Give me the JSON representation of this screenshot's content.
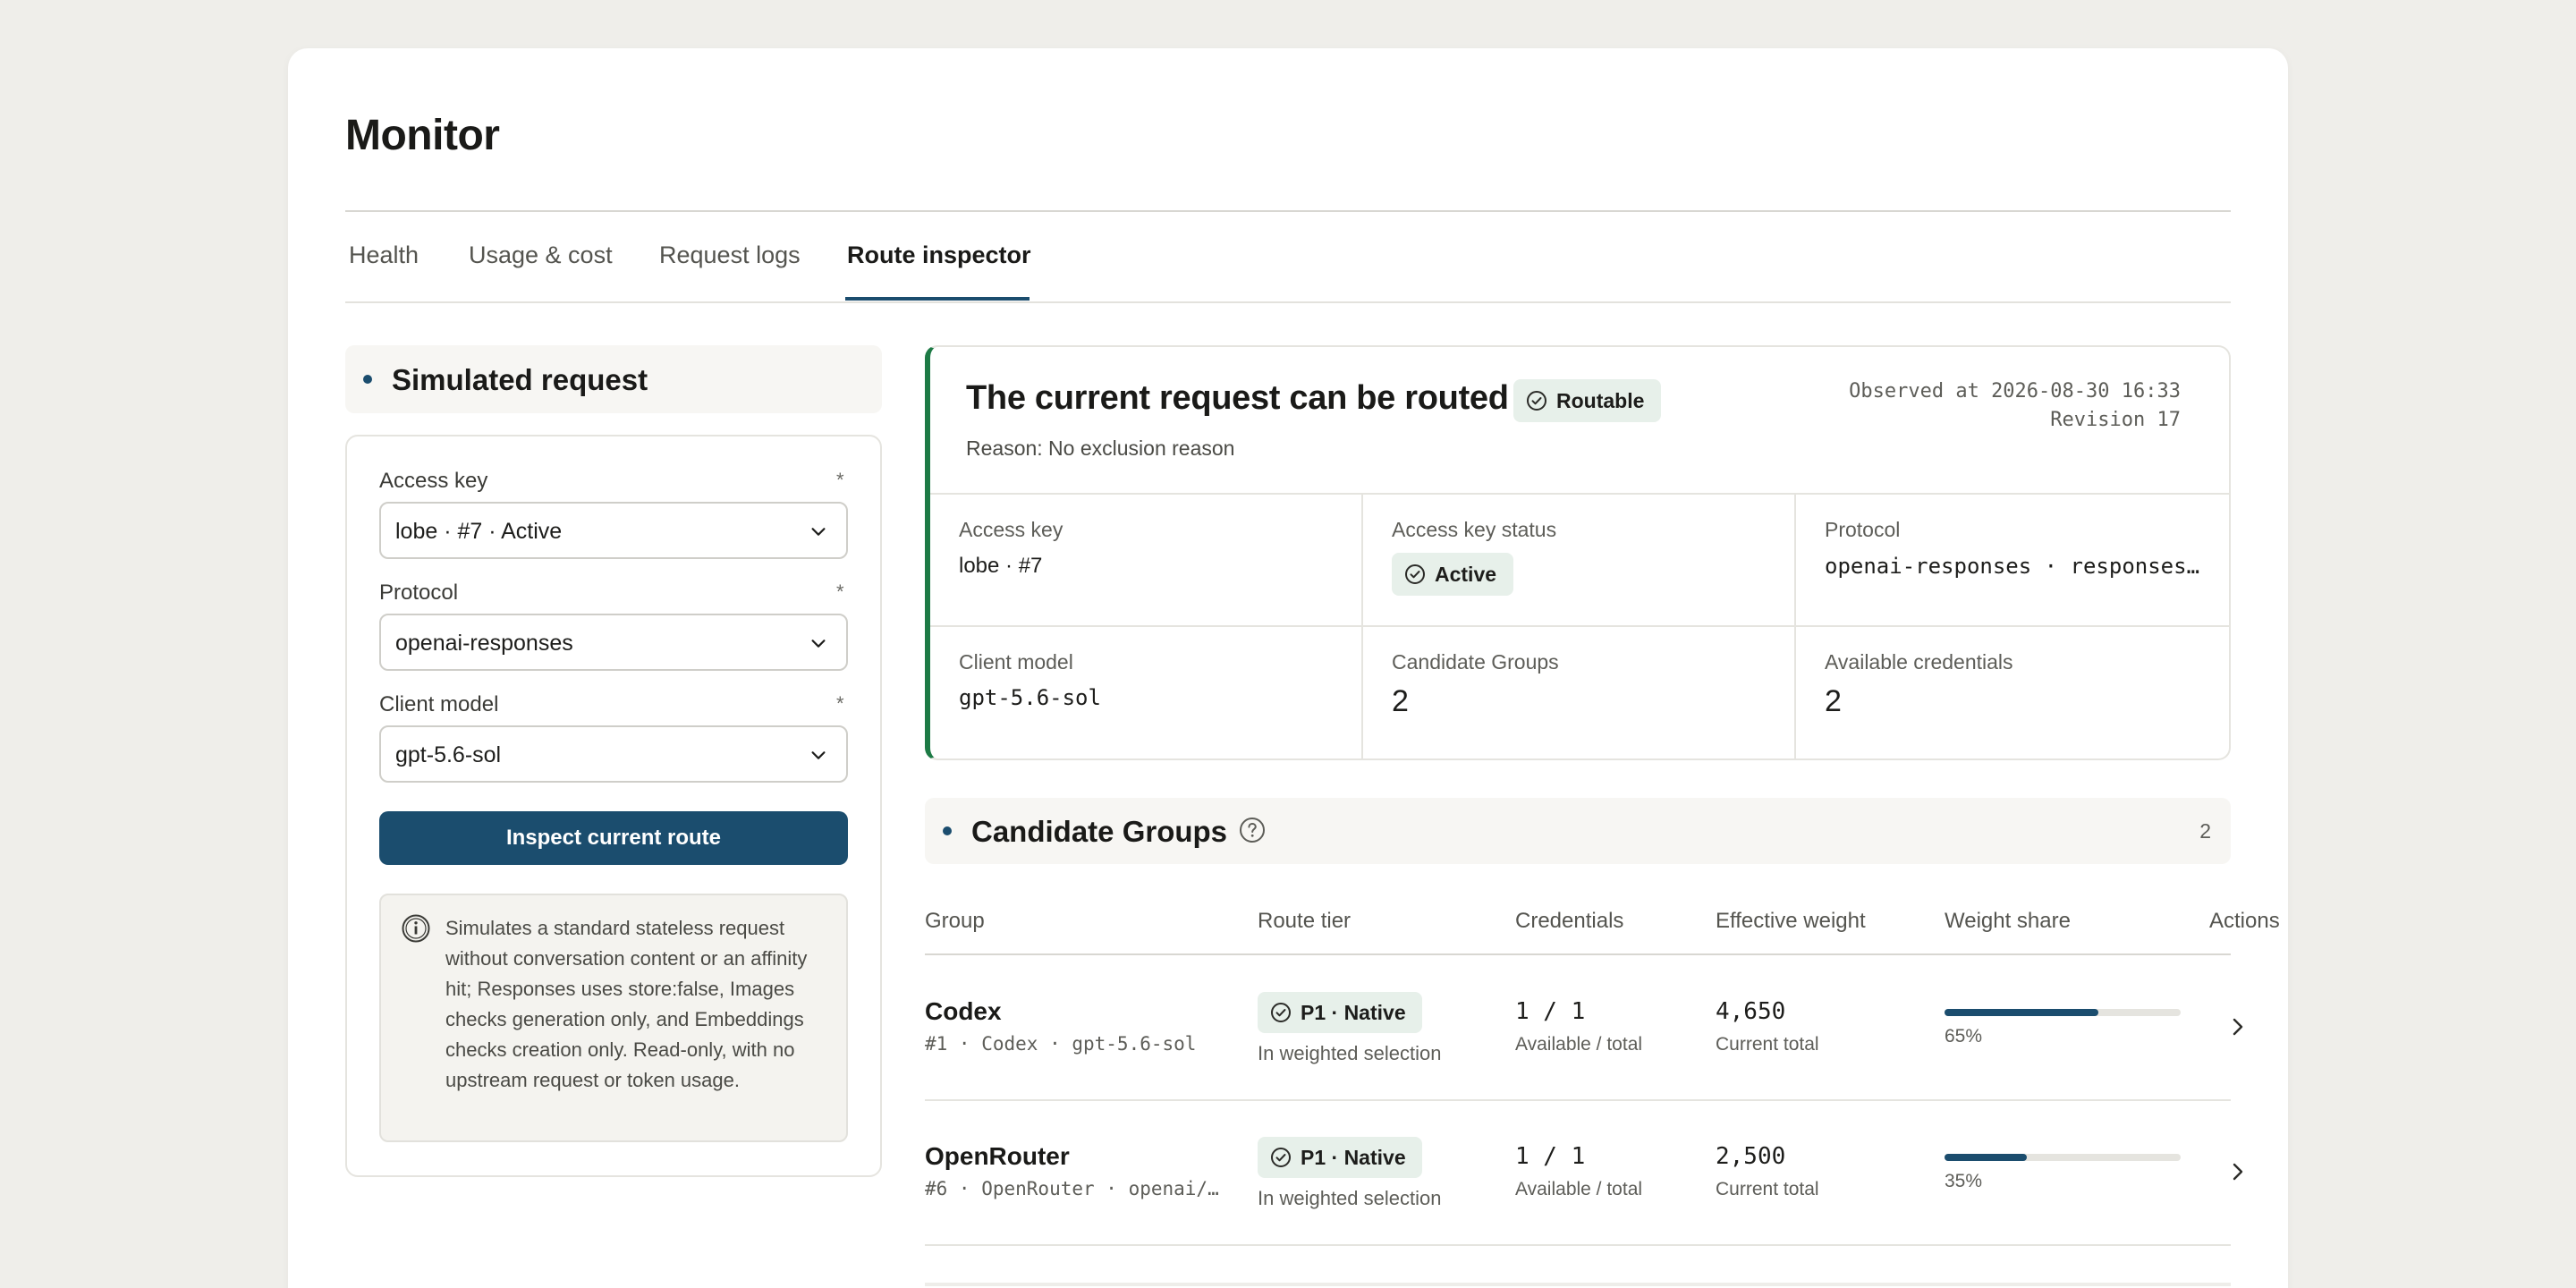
{
  "page": {
    "title": "Monitor"
  },
  "tabs": [
    {
      "label": "Health"
    },
    {
      "label": "Usage & cost"
    },
    {
      "label": "Request logs"
    },
    {
      "label": "Route inspector",
      "active": true
    }
  ],
  "simulated_request": {
    "title": "Simulated request",
    "required_mark": "*",
    "fields": [
      {
        "label": "Access key",
        "value": "lobe · #7 · Active"
      },
      {
        "label": "Protocol",
        "value": "openai-responses"
      },
      {
        "label": "Client model",
        "value": "gpt-5.6-sol"
      }
    ],
    "submit_label": "Inspect current route",
    "note": "Simulates a standard stateless request without conversation content or an affinity hit; Responses uses store:false, Images checks generation only, and Embeddings checks creation only. Read-only, with no upstream request or token usage."
  },
  "status": {
    "title": "The current request can be routed",
    "badge": "Routable",
    "reason": "Reason: No exclusion reason",
    "observed": "Observed at 2026-08-30 16:33",
    "revision": "Revision 17",
    "cells": {
      "access_key_label": "Access key",
      "access_key_value": "lobe · #7",
      "access_key_status_label": "Access key status",
      "access_key_status_value": "Active",
      "protocol_label": "Protocol",
      "protocol_value": "openai-responses · responses…",
      "client_model_label": "Client model",
      "client_model_value": "gpt-5.6-sol",
      "candidate_groups_label": "Candidate Groups",
      "candidate_groups_value": "2",
      "available_credentials_label": "Available credentials",
      "available_credentials_value": "2"
    }
  },
  "candidate_groups": {
    "title": "Candidate Groups",
    "count": "2",
    "columns": [
      "Group",
      "Route tier",
      "Credentials",
      "Effective weight",
      "Weight share",
      "Actions"
    ],
    "rows": [
      {
        "name": "Codex",
        "sub": "#1 · Codex · gpt-5.6-sol",
        "tier": "P1 · Native",
        "tier_sub": "In weighted selection",
        "credentials": "1 / 1",
        "credentials_sub": "Available / total",
        "weight": "4,650",
        "weight_sub": "Current total",
        "share_label": "65%",
        "share": 0.65
      },
      {
        "name": "OpenRouter",
        "sub": "#6 · OpenRouter · openai/…",
        "tier": "P1 · Native",
        "tier_sub": "In weighted selection",
        "credentials": "1 / 1",
        "credentials_sub": "Available / total",
        "weight": "2,500",
        "weight_sub": "Current total",
        "share_label": "35%",
        "share": 0.35
      }
    ]
  },
  "colors": {
    "accent": "#1b4d6e",
    "success_border": "#1d7a45",
    "badge_bg": "#e7f0ea"
  }
}
